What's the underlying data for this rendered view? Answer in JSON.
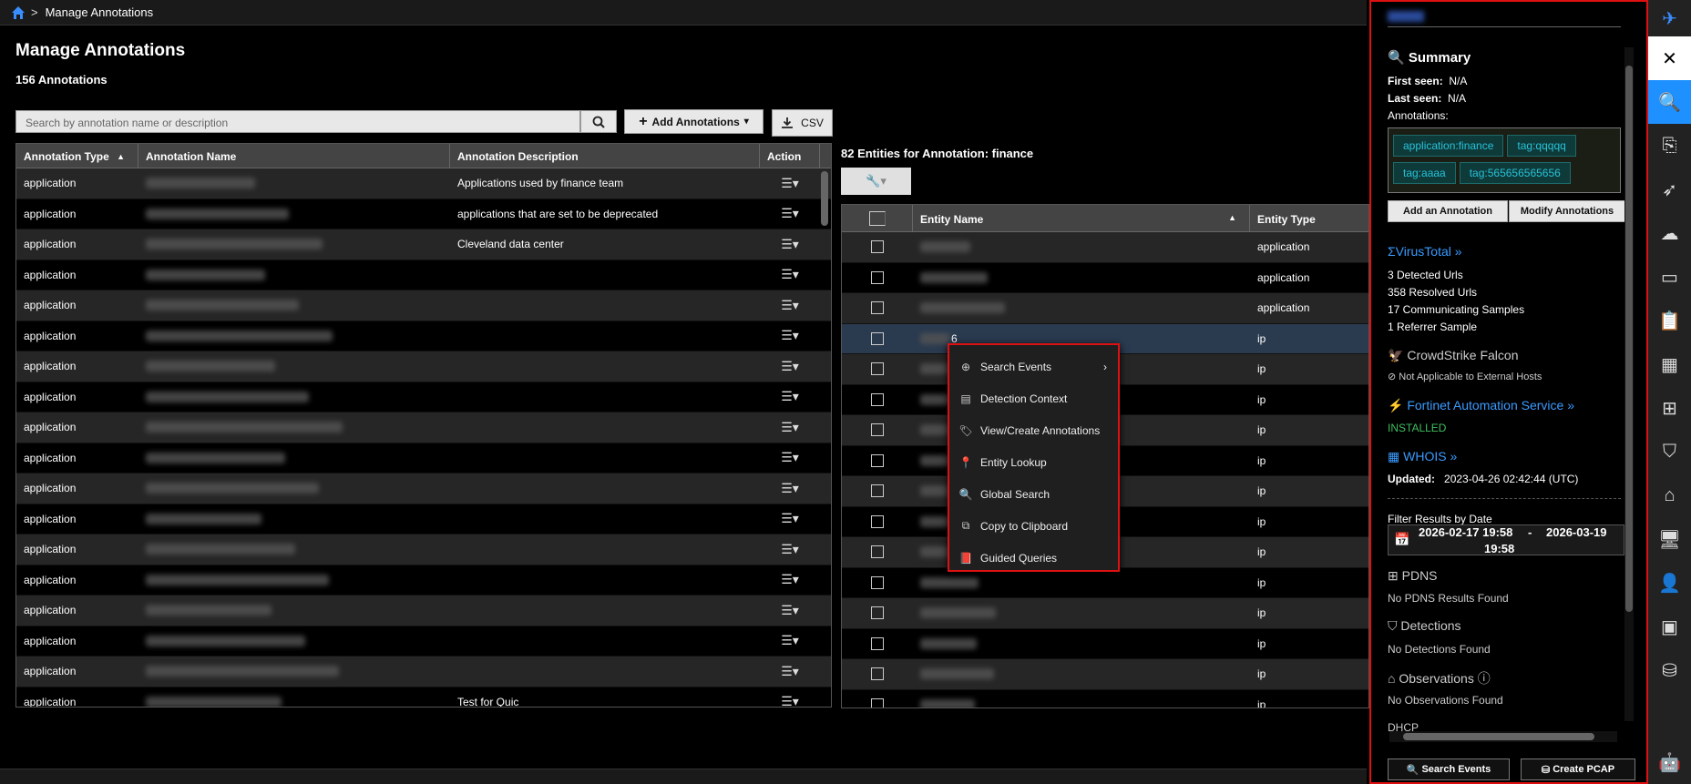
{
  "breadcrumb": {
    "separator": ">",
    "current": "Manage Annotations"
  },
  "page": {
    "title": "Manage Annotations",
    "count": "156 Annotations"
  },
  "search": {
    "placeholder": "Search by annotation name or description"
  },
  "toolbar": {
    "add_label": "Add Annotations",
    "csv_label": "CSV"
  },
  "annotations_table": {
    "headers": [
      "Annotation Type",
      "Annotation Name",
      "Annotation Description",
      "Action"
    ],
    "rows": [
      {
        "type": "application",
        "desc": "Applications used by finance team"
      },
      {
        "type": "application",
        "desc": "applications that are set to be deprecated"
      },
      {
        "type": "application",
        "desc": "Cleveland data center"
      },
      {
        "type": "application",
        "desc": ""
      },
      {
        "type": "application",
        "desc": ""
      },
      {
        "type": "application",
        "desc": ""
      },
      {
        "type": "application",
        "desc": ""
      },
      {
        "type": "application",
        "desc": ""
      },
      {
        "type": "application",
        "desc": ""
      },
      {
        "type": "application",
        "desc": ""
      },
      {
        "type": "application",
        "desc": ""
      },
      {
        "type": "application",
        "desc": ""
      },
      {
        "type": "application",
        "desc": ""
      },
      {
        "type": "application",
        "desc": ""
      },
      {
        "type": "application",
        "desc": ""
      },
      {
        "type": "application",
        "desc": ""
      },
      {
        "type": "application",
        "desc": ""
      },
      {
        "type": "application",
        "desc": "Test for Quic"
      }
    ]
  },
  "entities": {
    "title": "82 Entities for Annotation: finance",
    "headers": [
      "Entity Name",
      "Entity Type"
    ],
    "partial_name": "6",
    "types": [
      "application",
      "application",
      "application",
      "ip",
      "ip",
      "ip",
      "ip",
      "ip",
      "ip",
      "ip",
      "ip",
      "ip",
      "ip",
      "ip",
      "ip",
      "ip"
    ]
  },
  "context_menu": {
    "items": [
      "Search Events",
      "Detection Context",
      "View/Create Annotations",
      "Entity Lookup",
      "Global Search",
      "Copy to Clipboard",
      "Guided Queries"
    ]
  },
  "panel": {
    "summary_title": "Summary",
    "first_seen_label": "First seen:",
    "first_seen": "N/A",
    "last_seen_label": "Last seen:",
    "last_seen": "N/A",
    "annotations_label": "Annotations:",
    "tags": [
      "application:finance",
      "tag:qqqqq",
      "tag:aaaa",
      "tag:565656565656"
    ],
    "add_annotation": "Add an Annotation",
    "modify_annotations": "Modify Annotations",
    "virustotal": "VirusTotal »",
    "vt_lines": [
      "3 Detected Urls",
      "358 Resolved Urls",
      "17 Communicating Samples",
      "1 Referrer Sample"
    ],
    "crowdstrike": "CrowdStrike Falcon",
    "crowdstrike_note": "Not Applicable to External Hosts",
    "fortinet": "Fortinet Automation Service »",
    "installed": "INSTALLED",
    "whois": "WHOIS »",
    "updated_label": "Updated:",
    "updated": "2023-04-26 02:42:44 (UTC)",
    "filter_label": "Filter Results by Date",
    "date_from": "2026-02-17 19:58",
    "date_dash": "-",
    "date_to": "2026-03-19",
    "date_to_time": "19:58",
    "pdns": "PDNS",
    "pdns_none": "No PDNS Results Found",
    "detections": "Detections",
    "detections_none": "No Detections Found",
    "observations": "Observations",
    "observations_none": "No Observations Found",
    "dhcp": "DHCP",
    "search_events": "Search Events",
    "create_pcap": "Create PCAP"
  },
  "colors": {
    "accent": "#1e90ff",
    "highlight_border": "#dd1111",
    "tag_text": "#26c2d8",
    "installed": "#3fbf5f"
  }
}
